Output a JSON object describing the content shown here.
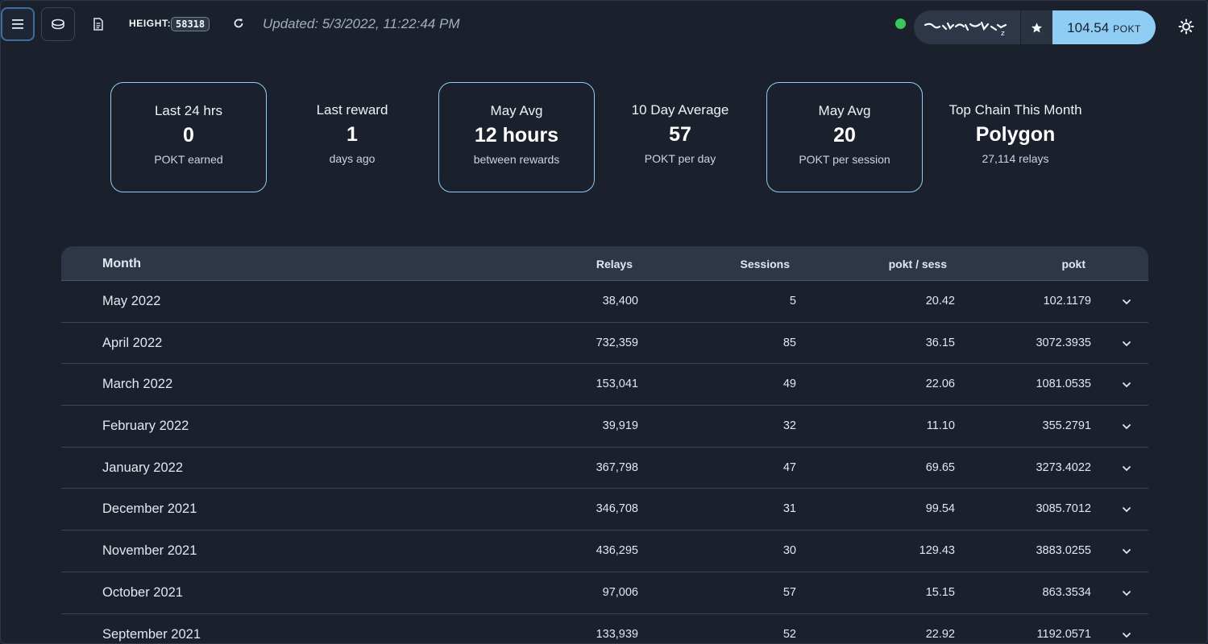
{
  "header": {
    "height_label": "HEIGHT:",
    "height_value": "58318",
    "updated": "Updated: 5/3/2022, 11:22:44 PM",
    "balance_value": "104.54",
    "balance_unit": "POKT",
    "status_color": "#38c95a",
    "accent_color": "#90cdf4",
    "icons": [
      "menu-icon",
      "node-icon",
      "document-icon",
      "refresh-icon",
      "wallet-avatar-icon",
      "star-icon",
      "sun-icon"
    ]
  },
  "stats": [
    {
      "label": "Last 24 hrs",
      "value": "0",
      "sub": "POKT earned"
    },
    {
      "label": "Last reward",
      "value": "1",
      "sub": "days ago"
    },
    {
      "label": "May Avg",
      "value": "12 hours",
      "sub": "between rewards"
    },
    {
      "label": "10 Day Average",
      "value": "57",
      "sub": "POKT per day"
    },
    {
      "label": "May Avg",
      "value": "20",
      "sub": "POKT per session"
    },
    {
      "label": "Top Chain This Month",
      "value": "Polygon",
      "sub": "27,114 relays"
    }
  ],
  "table": {
    "headers": {
      "month": "Month",
      "relays": "Relays",
      "sessions": "Sessions",
      "pokt_per_sess": "pokt / sess",
      "pokt": "pokt"
    },
    "rows": [
      {
        "month": "May 2022",
        "relays": "38,400",
        "sessions": "5",
        "pps": "20.42",
        "pokt": "102.1179"
      },
      {
        "month": "April 2022",
        "relays": "732,359",
        "sessions": "85",
        "pps": "36.15",
        "pokt": "3072.3935"
      },
      {
        "month": "March 2022",
        "relays": "153,041",
        "sessions": "49",
        "pps": "22.06",
        "pokt": "1081.0535"
      },
      {
        "month": "February 2022",
        "relays": "39,919",
        "sessions": "32",
        "pps": "11.10",
        "pokt": "355.2791"
      },
      {
        "month": "January 2022",
        "relays": "367,798",
        "sessions": "47",
        "pps": "69.65",
        "pokt": "3273.4022"
      },
      {
        "month": "December 2021",
        "relays": "346,708",
        "sessions": "31",
        "pps": "99.54",
        "pokt": "3085.7012"
      },
      {
        "month": "November 2021",
        "relays": "436,295",
        "sessions": "30",
        "pps": "129.43",
        "pokt": "3883.0255"
      },
      {
        "month": "October 2021",
        "relays": "97,006",
        "sessions": "57",
        "pps": "15.15",
        "pokt": "863.3534"
      },
      {
        "month": "September 2021",
        "relays": "133,939",
        "sessions": "52",
        "pps": "22.92",
        "pokt": "1192.0571"
      }
    ]
  }
}
